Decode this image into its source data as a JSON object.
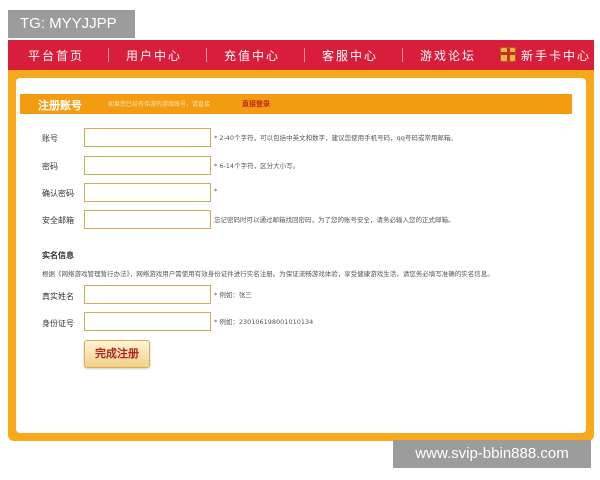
{
  "tg_badge": "TG: MYYJJPP",
  "nav": {
    "items": [
      "平台首页",
      "用户中心",
      "充值中心",
      "客服中心",
      "游戏论坛",
      "新手卡中心"
    ]
  },
  "form": {
    "header_title": "注册账号",
    "header_hint": "如果您已经有伟游的游戏账号，请直接",
    "header_link": "直接登录",
    "fields": [
      {
        "label": "账号",
        "note": "* 2-40个字符，可以包括中英文和数字，建议您使用手机号码，qq号码或常用邮箱。"
      },
      {
        "label": "密码",
        "note": "* 6-14个字符，区分大小写。"
      },
      {
        "label": "确认密码",
        "note": "*"
      },
      {
        "label": "安全邮箱",
        "note": "忘记密码时可以通过邮箱找回密码，为了您的账号安全，请务必输入您的正式邮箱。"
      }
    ],
    "realname_title": "实名信息",
    "realname_desc": "根据《网络游戏管理暂行办法》，网络游戏用户需使用有效身份证件进行实名注册。为保证流畅游戏体验，享受健康游戏生活，请您务必填写准确的实名信息。",
    "realname_fields": [
      {
        "label": "真实姓名",
        "note": "* 例如：张三"
      },
      {
        "label": "身份证号",
        "note": "* 例如：230106198001010134"
      }
    ],
    "submit_label": "完成注册"
  },
  "watermark": "www.svip-bbin888.com"
}
